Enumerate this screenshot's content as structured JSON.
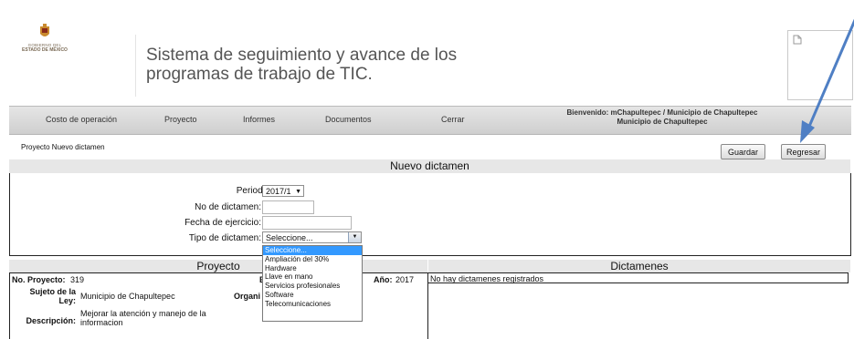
{
  "header": {
    "logo_line1": "GOBIERNO DEL",
    "logo_line2": "ESTADO DE MÉXICO",
    "app_title_line1": "Sistema de seguimiento y avance de los",
    "app_title_line2": "programas de trabajo de TIC."
  },
  "nav": {
    "items": [
      "Costo de operación",
      "Proyecto",
      "Informes",
      "Documentos",
      "Cerrar"
    ],
    "welcome_line1": "Bienvenido: mChapultepec / Municipio de Chapultepec",
    "welcome_line2": "Municipio de Chapultepec"
  },
  "breadcrumb": "Proyecto Nuevo dictamen",
  "buttons": {
    "save": "Guardar",
    "back": "Regresar"
  },
  "form": {
    "title": "Nuevo dictamen",
    "periodo_label": "Periodo:",
    "periodo_value": "2017/1",
    "no_dictamen_label": "No de dictamen:",
    "no_dictamen_value": "",
    "fecha_label": "Fecha de ejercicio:",
    "fecha_value": "",
    "tipo_label": "Tipo de dictamen:",
    "tipo_value": "Seleccione...",
    "tipo_options": [
      "Seleccione...",
      "Ampliación del 30%",
      "Hardware",
      "Llave en mano",
      "Servicios profesionales",
      "Software",
      "Telecomunicaciones"
    ],
    "tipo_selected_index": 0
  },
  "proyecto": {
    "title": "Proyecto",
    "no_label": "No. Proyecto:",
    "no_value": "319",
    "e_label": "E",
    "anio_label": "Año:",
    "anio_value": "2017",
    "sujeto_label_1": "Sujeto de la",
    "sujeto_label_2": "Ley:",
    "sujeto_value": "Municipio de Chapultepec",
    "organi_label": "Organi",
    "descripcion_label": "Descripción:",
    "descripcion_value_1": "Mejorar la atención y manejo de la",
    "descripcion_value_2": "informacion"
  },
  "dictamenes": {
    "title": "Dictamenes",
    "empty_message": "No hay dictamenes registrados"
  },
  "colors": {
    "nav_bg": "#d9d9d9",
    "section_bg": "#e7e7e7",
    "selected_option": "#3399ff",
    "arrow": "#4f7fc4"
  }
}
